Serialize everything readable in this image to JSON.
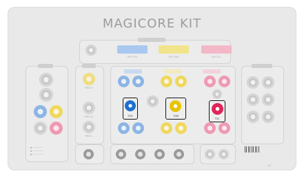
{
  "title": "MAGICORE KIT",
  "highlighted": [
    {
      "label": "TGS",
      "color": "#1d6fd0"
    },
    {
      "label": "TGM",
      "color": "#e7c400"
    },
    {
      "label": "TGL",
      "color": "#e0245a"
    }
  ],
  "slots": [
    {
      "label": "Pre-TGS",
      "color": "#a8c8ef"
    },
    {
      "label": "Pre-TGM",
      "color": "#f2e48a"
    },
    {
      "label": "Pre-TGL",
      "color": "#f2b8c8"
    }
  ],
  "left_labels": [
    "REG-S",
    "REG-M",
    "REG-L",
    "REG-S",
    "REG-M"
  ],
  "status": {
    "page": "1/1"
  }
}
